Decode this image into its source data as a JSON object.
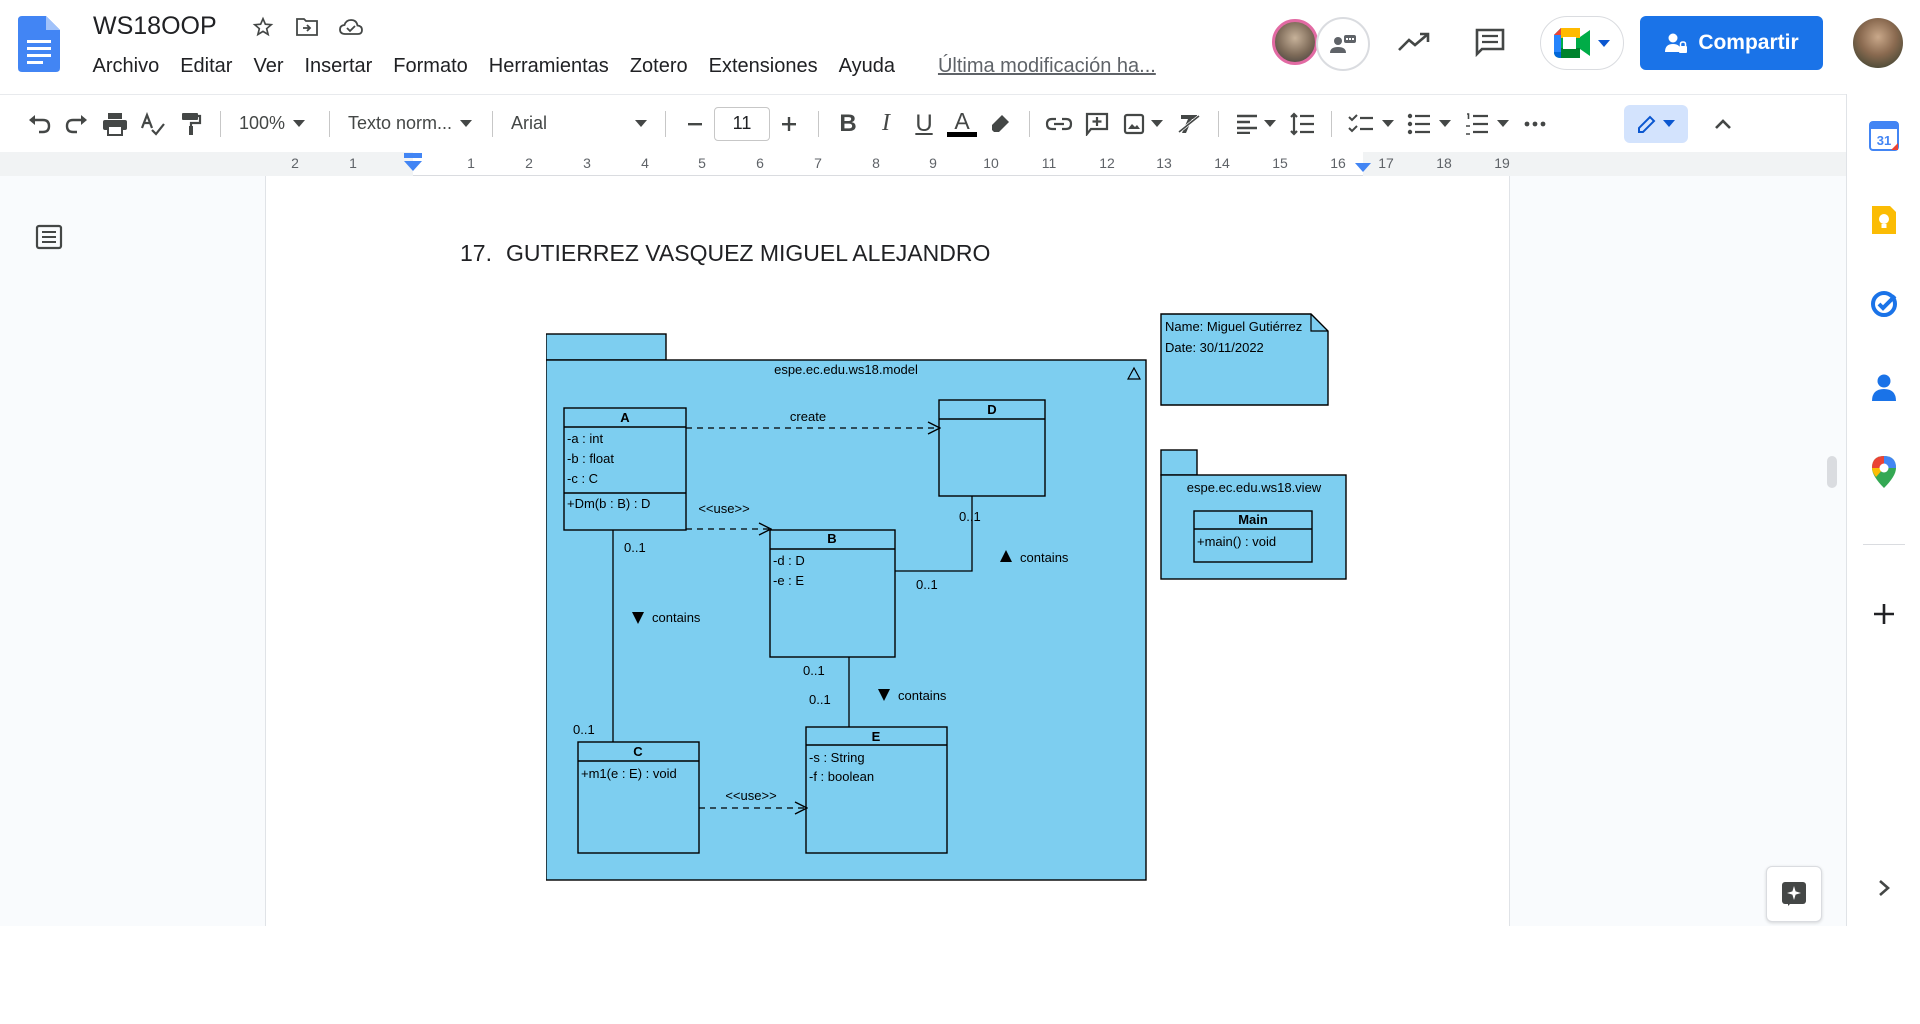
{
  "header": {
    "doc_title": "WS18OOP",
    "menu": [
      "Archivo",
      "Editar",
      "Ver",
      "Insertar",
      "Formato",
      "Herramientas",
      "Zotero",
      "Extensiones",
      "Ayuda"
    ],
    "last_edit": "Última modificación ha...",
    "share_label": "Compartir",
    "icons": [
      "star-icon",
      "move-icon",
      "cloud-status-icon",
      "activity-icon",
      "comments-icon",
      "meet-icon"
    ]
  },
  "toolbar": {
    "zoom": "100%",
    "style": "Texto norm...",
    "font": "Arial",
    "font_size": "11",
    "bold_label": "B",
    "italic_label": "I",
    "underline_label": "U",
    "text_color_label": "A",
    "text_color": "#000000"
  },
  "ruler": {
    "labels": [
      "2",
      "1",
      "1",
      "2",
      "3",
      "4",
      "5",
      "6",
      "7",
      "8",
      "9",
      "10",
      "11",
      "12",
      "13",
      "14",
      "15",
      "16",
      "17",
      "18",
      "19"
    ]
  },
  "document": {
    "heading_number": "17.",
    "heading_text": "GUTIERREZ VASQUEZ MIGUEL ALEJANDRO"
  },
  "diagram": {
    "fill": "#7dcef0",
    "package_model": "espe.ec.edu.ws18.model",
    "package_view": "espe.ec.edu.ws18.view",
    "note_name": "Name: Miguel Gutiérrez",
    "note_date": "Date: 30/11/2022",
    "class_a": {
      "name": "A",
      "attrs": [
        "-a : int",
        "-b : float",
        "-c : C"
      ],
      "ops": [
        "+Dm(b : B) : D"
      ]
    },
    "class_b": {
      "name": "B",
      "attrs": [
        "-d : D",
        "-e : E"
      ]
    },
    "class_c": {
      "name": "C",
      "attrs": [
        "+m1(e : E) : void"
      ]
    },
    "class_d": {
      "name": "D"
    },
    "class_e": {
      "name": "E",
      "attrs": [
        "-s : String",
        "-f : boolean"
      ]
    },
    "class_main": {
      "name": "Main",
      "ops": [
        "+main() : void"
      ]
    },
    "labels": {
      "create": "create",
      "use1": "<<use>>",
      "use2": "<<use>>",
      "contains": "contains",
      "mult": "0..1"
    }
  },
  "sidepanel": {
    "calendar_day": "31",
    "icons": [
      "calendar-icon",
      "keep-icon",
      "tasks-icon",
      "contacts-icon",
      "maps-icon",
      "add-icon",
      "expand-icon"
    ]
  }
}
